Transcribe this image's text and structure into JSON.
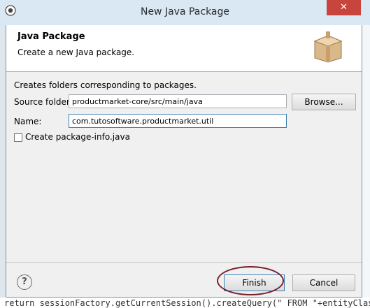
{
  "window": {
    "title": "New Java Package",
    "close_glyph": "✕"
  },
  "banner": {
    "heading": "Java Package",
    "description": "Create a new Java package."
  },
  "form": {
    "description": "Creates folders corresponding to packages.",
    "source_folder_label": "Source folder:",
    "source_folder_value": "productmarket-core/src/main/java",
    "browse_label": "Browse...",
    "name_label": "Name:",
    "name_value": "com.tutosoftware.productmarket.util",
    "create_package_info_label": "Create package-info.java",
    "create_package_info_checked": false
  },
  "footer": {
    "help_glyph": "?",
    "finish_label": "Finish",
    "cancel_label": "Cancel"
  },
  "background": {
    "code_line": "return sessionFactory.getCurrentSession().createQuery(\" FROM \"+entityClass"
  },
  "colors": {
    "title_bar": "#d9e8f3",
    "close_button": "#c7453d",
    "annotation_circle": "#7a1f2e"
  },
  "icons": {
    "window": "eclipse-icon",
    "banner": "package-icon",
    "help": "help-icon"
  }
}
